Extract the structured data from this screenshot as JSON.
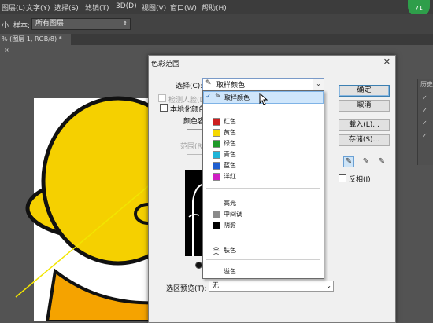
{
  "menubar": [
    "图层(L)",
    "文字(Y)",
    "选择(S)",
    "滤镜(T)",
    "3D(D)",
    "视图(V)",
    "窗口(W)",
    "帮助(H)"
  ],
  "options": {
    "sample_label": "样本:",
    "sample_value": "所有图层",
    "left_fragment": "小"
  },
  "doc_tab": "% (图层 1, RGB/8) *",
  "avatar_text": "71",
  "right_panel_title": "历史",
  "dialog": {
    "title": "色彩范围",
    "select_label": "选择(C):",
    "select_value": "取样颜色",
    "detect_faces": "检测人脸(D",
    "localized": "本地化颜色",
    "fuzziness": "颜色容",
    "range": "范围(R",
    "buttons": [
      "确定",
      "取消",
      "载入(L)...",
      "存储(S)..."
    ],
    "invert": "反相(I)",
    "selection_preview_label": "选区预览(T):",
    "selection_preview_value": "无"
  },
  "dropdown": {
    "items": [
      {
        "label": "取样颜色",
        "color": null,
        "selected": true,
        "icon": "eyedropper-icon"
      },
      {
        "label": "红色",
        "color": "#cc1f1f"
      },
      {
        "label": "黄色",
        "color": "#f5d800"
      },
      {
        "label": "绿色",
        "color": "#1f9a2a"
      },
      {
        "label": "青色",
        "color": "#1fb5d9"
      },
      {
        "label": "蓝色",
        "color": "#1f5fd0"
      },
      {
        "label": "洋红",
        "color": "#d01fc4"
      },
      {
        "label": "高光",
        "color": "#ffffff"
      },
      {
        "label": "中间调",
        "color": "#8a8a8a"
      },
      {
        "label": "阴影",
        "color": "#000000"
      },
      {
        "label": "肤色",
        "color": null,
        "icon": "person-icon"
      },
      {
        "label": "溢色",
        "color": null
      }
    ]
  },
  "colors": {
    "accent": "#3c7fb1",
    "mascot_yellow": "#f5d000",
    "line_yellow": "#f2e500"
  }
}
